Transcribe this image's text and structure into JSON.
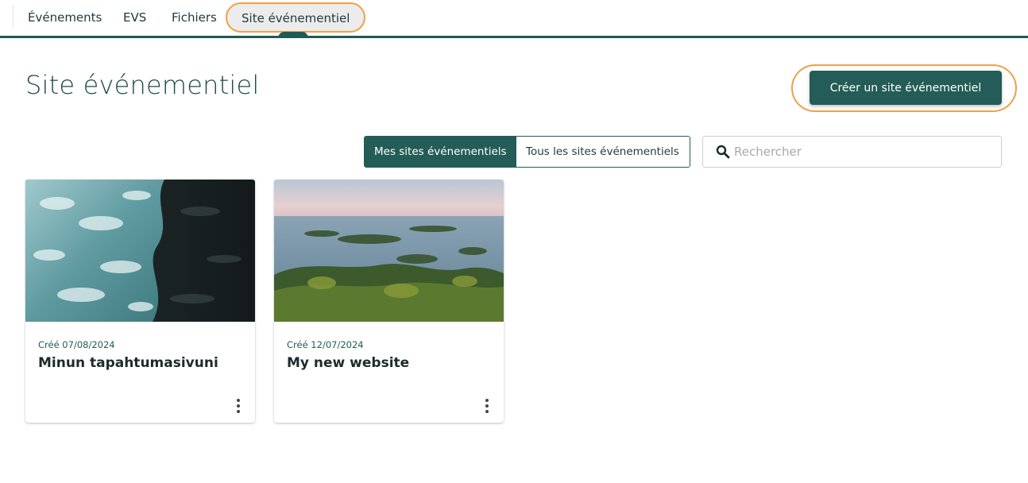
{
  "nav": {
    "tabs": [
      {
        "label": "Événements"
      },
      {
        "label": "EVS"
      },
      {
        "label": "Fichiers"
      },
      {
        "label": "Site événementiel",
        "active": true
      }
    ]
  },
  "header": {
    "title": "Site événementiel",
    "create_button": "Créer un site événementiel"
  },
  "filters": {
    "mine": "Mes sites événementiels",
    "all": "Tous les sites événementiels",
    "selected": "Mes sites événementiels"
  },
  "search": {
    "placeholder": "Rechercher",
    "value": ""
  },
  "cards": [
    {
      "created": "Créé 07/08/2024",
      "title": "Minun tapahtumasivuni",
      "image": "ocean-waves-aerial-photo"
    },
    {
      "created": "Créé 12/07/2024",
      "title": "My new website",
      "image": "lake-islands-aerial-photo"
    }
  ],
  "icons": {
    "search": "search-icon",
    "more": "more-vertical-icon"
  },
  "colors": {
    "primary": "#245c57",
    "highlight": "#f0a04b",
    "nav_underline": "#1f5a55"
  }
}
